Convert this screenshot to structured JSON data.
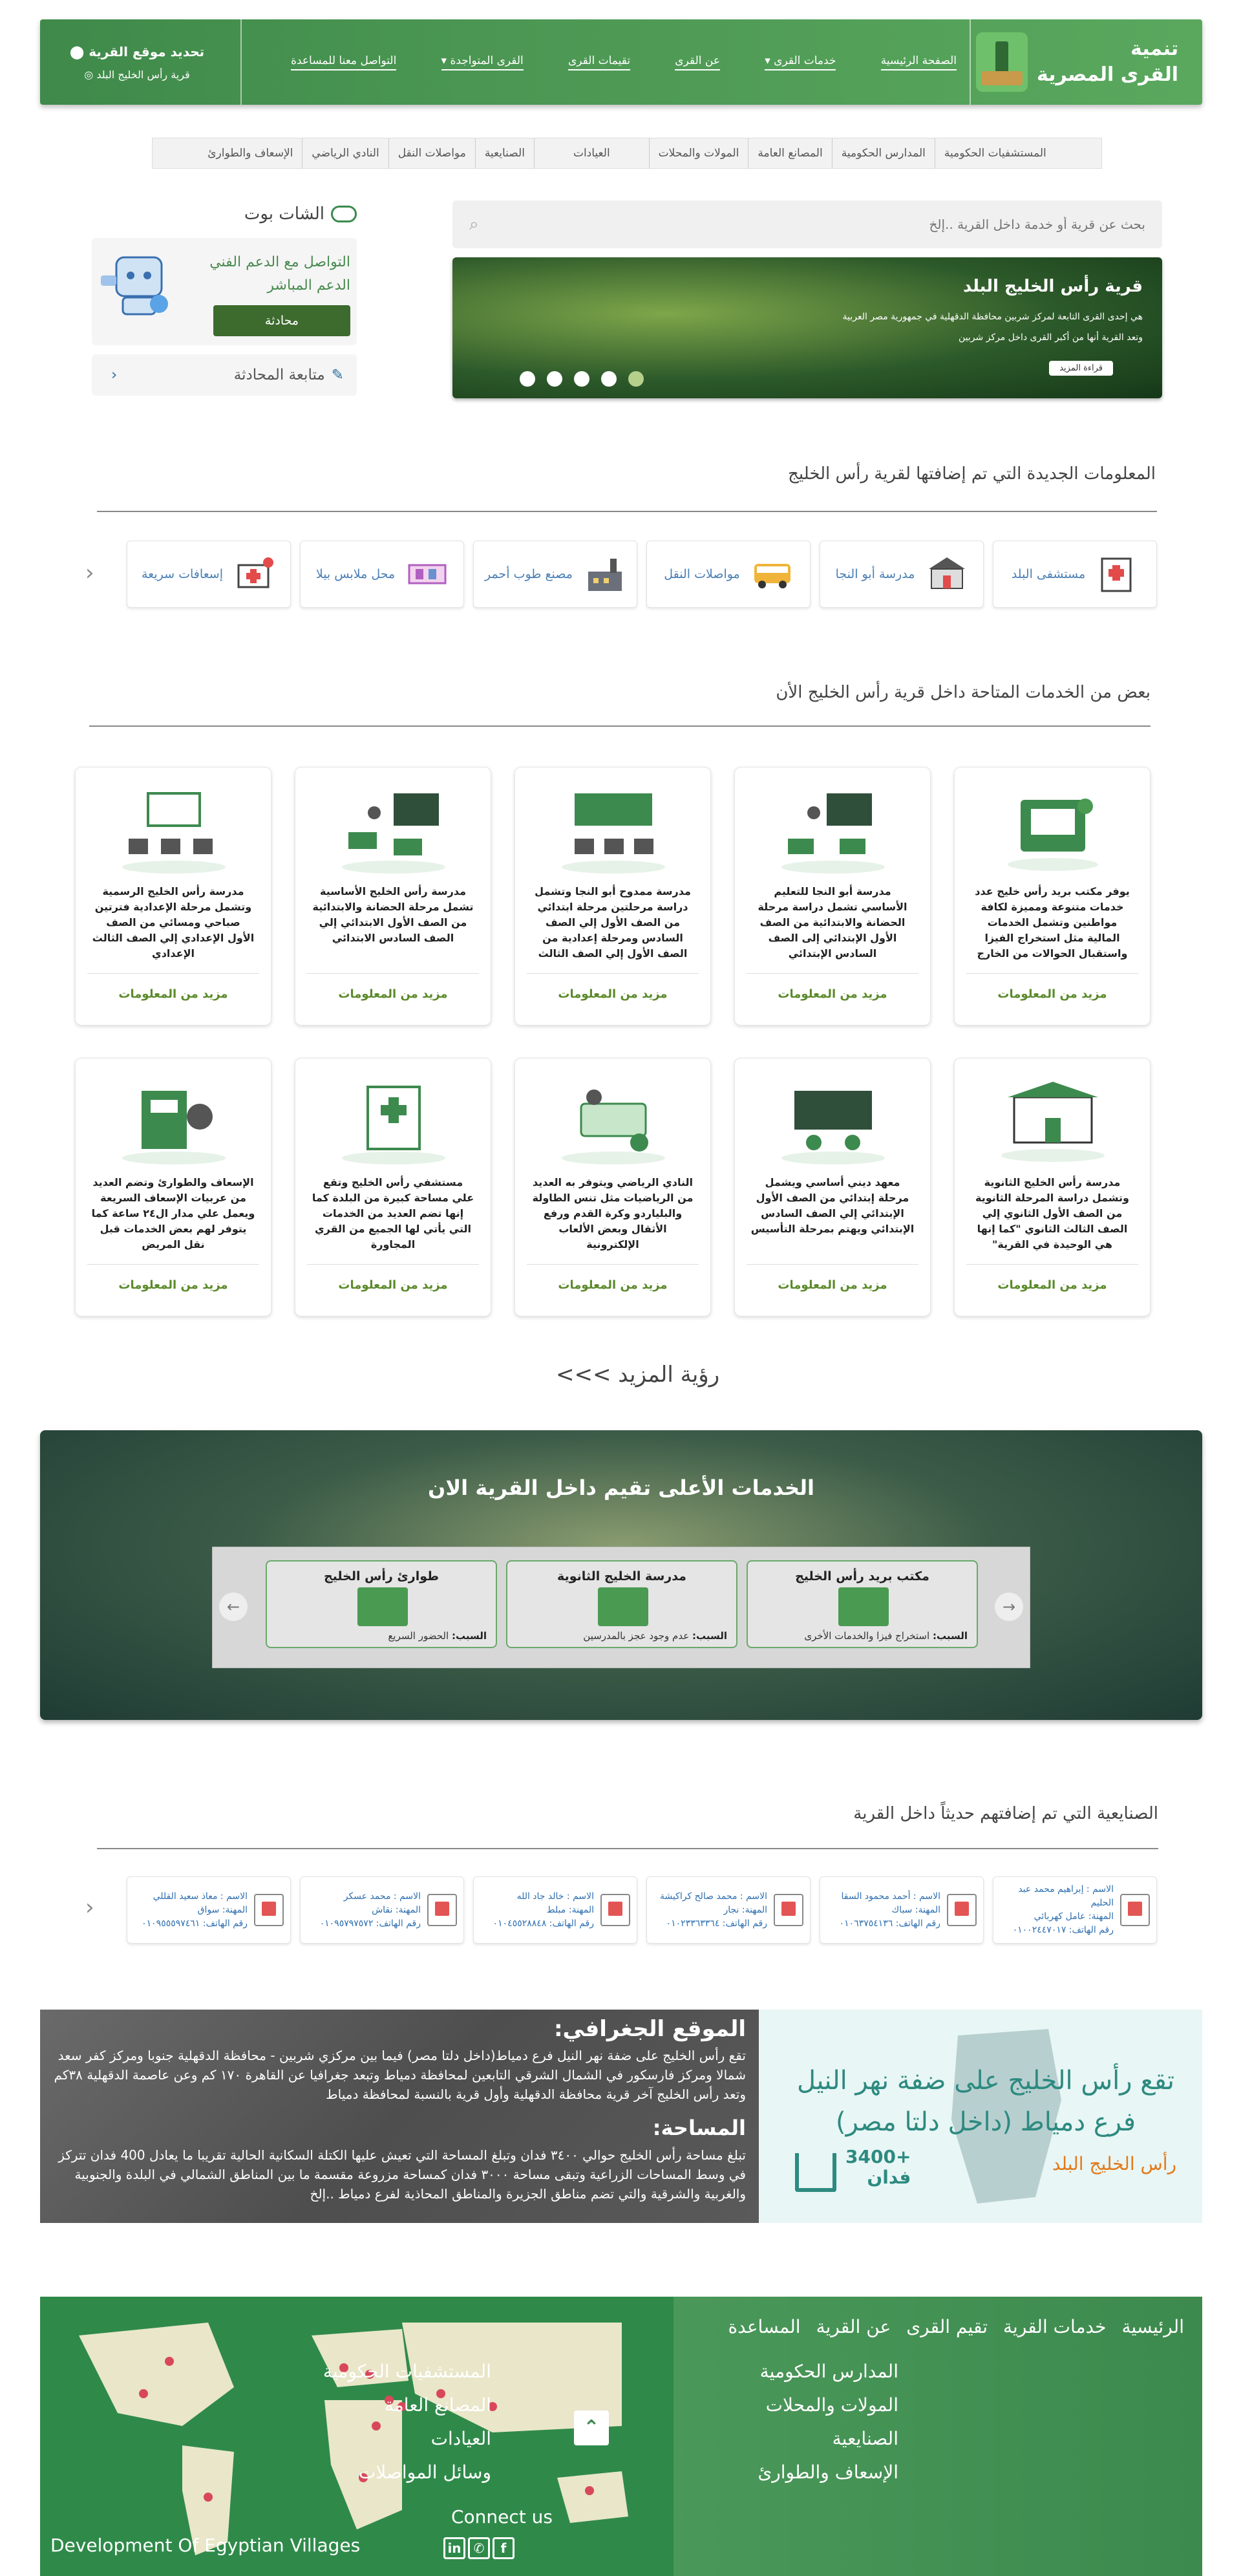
{
  "header": {
    "brand_line1": "تنمية",
    "brand_line2": "القرى المصرية",
    "nav": [
      "الصفحة الرئيسية",
      "خدمات القرى",
      "عن القرى",
      "تقيمات القرى",
      "القرى المتواجدة",
      "التواصل معنا للمساعدة"
    ],
    "location_title": "تحديد موقع القرية",
    "location_value": "قرية رأس الخليج البلد"
  },
  "categories": [
    "المستشفيات الحكومية",
    "المدارس الحكومية",
    "المصانع العامة",
    "المولات والمحلات",
    "العيادات",
    "الصنايعية",
    "مواصلات النقل",
    "النادي الرياضي",
    "الإسعاف والطوارئ"
  ],
  "search": {
    "placeholder": "بحث عن قرية أو خدمة داخل القرية ..إلخ"
  },
  "slider": {
    "title": "قرية رأس الخليج البلد",
    "desc1": "هي إحدى القرى التابعة لمركز شربين محافظة الدقهلية في جمهورية مصر العربية",
    "desc2": "وتعد القرية أنها من أكبر القرى داخل مركز شربين",
    "button": "قراءة المزيد"
  },
  "chat": {
    "title": "الشات بوت",
    "support": "التواصل مع الدعم الفني الدعم المباشر",
    "button": "محادثة",
    "follow": "متابعة المحادثة"
  },
  "new_info": {
    "title": "المعلومات الجديدة التي تم إضافتها لقرية رأس الخليج",
    "items": [
      "مستشفى البلد",
      "مدرسة أبو النجا",
      "مواصلات النقل",
      "مصنع طوب أحمر",
      "محل ملابس بيلا",
      "إسعافات سريعة"
    ]
  },
  "services": {
    "title": "بعض من الخدمات المتاحة داخل قرية رأس الخليج الأن",
    "more": "مزيد من المعلومات",
    "row1": [
      "يوفر مكتب بريد رأس خليج عدد خدمات متنوعة ومميزة لكافة مواطنين وتشمل الخدمات المالية مثل استخراج الفيزا واستقبال الحوالات من الخارج",
      "مدرسة أبو النجا للتعليم الأساسي تشمل دراسة مرحلة الحضانة والابتدائية من الصف الأول الإبتدائي إلى الصف السادس الإبتدائي",
      "مدرسة ممدوح أبو النجا وتشمل دراسة مرحلتين مرحلة ابتدائي من الصف الأول إلي الصف السادس ومرحلة إعدادية من الصف الأول إلي الصف الثالث",
      "مدرسة رأس الخليج الأساسية تشمل مرحلة الحضانة والابتدائية من الصف الأول الابتدائي إلي الصف السادس الابتدائي",
      "مدرسة رأس الخليج الرسمية وتشمل مرحلة الإعدادية فترتين صباحي ومسائي من الصف الأول الإعدادي إلي الصف الثالث الإعدادي"
    ],
    "row2": [
      "مدرسة رأس الخليج الثانوية وتشمل دراسة المرحلة الثانوية من الصف الأول الثانوي إلي الصف الثالث الثانوي \"كما إنها هي الوحيدة في القرية\"",
      "معهد ديني أساسي ويشمل مرحلة إبتدائي من الصف الأول الإبتدائي إلي الصف السادس الإبتدائي ويهتم بمرحلة التأسيس",
      "النادي الرياضي ويتوفر به العديد من الرياضيات مثل تنس الطاولة والبلياردو وكرة القدم ورفع الأثقال وبعض الألعاب الإلكترونية",
      "مستشفي رأس الخليج وتقع علي مساحة كبيرة من البلدة كما إنها تضم العديد من الخدمات التي يأتي لها الجميع من القري المجاورة",
      "الإسعاف والطوارئ وتضم العديد من عربيات الإسعاف السريعة ويعمل علي مدار ال٢٤ ساعة كما يتوفر لهم بعض الخدمات قبل نقل المريض"
    ],
    "see_more": "رؤية المزيد >>>"
  },
  "top_rated": {
    "title": "الخدمات الأعلى تقيم داخل القرية الان",
    "reason_label": "السبب:",
    "items": [
      {
        "name": "مكتب بريد رأس الخليج",
        "reason": "استخراج فيزا والخدمات الأخرى"
      },
      {
        "name": "مدرسة الخليج الثانوية",
        "reason": "عدم وجود عجز بالمدرسين"
      },
      {
        "name": "طوارئ رأس الخليج",
        "reason": "الحضور السريع"
      }
    ]
  },
  "workers": {
    "title": "الصنايعية التي تم إضافتهم حديثاً داخل القرية",
    "items": [
      {
        "name": "الاسم : إبراهيم محمد عبد الحليم",
        "job": "المهنة: عامل كهربائي",
        "phone": "رقم الهاتف: ٠١٠٠٢٤٤٧٠١٧"
      },
      {
        "name": "الاسم : أحمد محمود السقا",
        "job": "المهنة: سباك",
        "phone": "رقم الهاتف: ٠١٠٦٣٧٥٤١٣٦"
      },
      {
        "name": "الاسم : محمد صالح كراكيشة",
        "job": "المهنة: نجار",
        "phone": "رقم الهاتف: ٠١٠٢٣٣٦٣٣٦٤"
      },
      {
        "name": "الاسم : خالد جاد الله",
        "job": "المهنة: مبلط",
        "phone": "رقم الهاتف: ٠١٠٤٥٥٢٨٨٤٨"
      },
      {
        "name": "الاسم : محمد عسكر",
        "job": "المهنة: نقاش",
        "phone": "رقم الهاتف: ٠١٠٩٥٧٩٧٥٧٢"
      },
      {
        "name": "الاسم : معاذ سعيد القللي",
        "job": "المهنة: سواق",
        "phone": "رقم الهاتف: ٠١٠٩٥٥٥٩٧٤٦١"
      }
    ]
  },
  "geo": {
    "title": "الموقع الجغرافي:",
    "text": "تقع رأس الخليج على ضفة نهر النيل فرع دمياط(داخل دلتا مصر) فيما بين مركزي شربين - محافظة الدقهلية جنوبا ومركز كفر سعد شمالا ومركز فارسكور في الشمال الشرقي التابعين لمحافظة دمياط وتبعد جغرافيا عن القاهرة ١٧٠ كم وعن عاصمة الدقهلية ٣٨كم وتعد رأس الخليج آخر قرية محافظة الدقهلية وأول قرية بالنسبة لمحافظة دمياط",
    "area_title": "المساحة:",
    "area_text": "تبلغ مساحة رأس الخليج حوالي ٣٤٠٠ فدان وتبلغ المساحة التي تعيش عليها الكتلة السكانية الحالية تقريبا ما يعادل 400 فدان تتركز في وسط المساحات الزراعية وتبقى مساحة ٣٠٠٠ فدان كمساحة مزروعة مقسمة ما بين المناطق الشمالي في البلدة والجنوبية والغربية والشرقية والتي تضم مناطق الجزيرة والمناطق المحاذية لفرع دمياط ..إلخ",
    "headline": "تقع رأس الخليج على ضفة نهر النيل فرع دمياط (داخل دلتا مصر)",
    "village": "رأس الخليج البلد",
    "area_value": "+3400",
    "area_unit": "فدان"
  },
  "footer": {
    "menu": [
      "الرئيسية",
      "خدمات القرية",
      "تقيم القرى",
      "عن القرية",
      "المساعدة"
    ],
    "col1": [
      "المستشفيات الحكومية",
      "المصانع العامة",
      "العيادات",
      "وسائل المواصلات"
    ],
    "col2": [
      "المدارس الحكومية",
      "المولات والمحلات",
      "الصنايعية",
      "الإسعاف والطوارئ"
    ],
    "connect": "Connect us",
    "dev": "Development Of Egyptian Villages",
    "top_icon": "double-chevron-up-icon"
  },
  "colors": {
    "brand_green": "#4e9a55",
    "link_blue": "#4a7fb5",
    "more_green": "#5b8a2a",
    "orange": "#e27a1a",
    "teal": "#2d8a80"
  }
}
